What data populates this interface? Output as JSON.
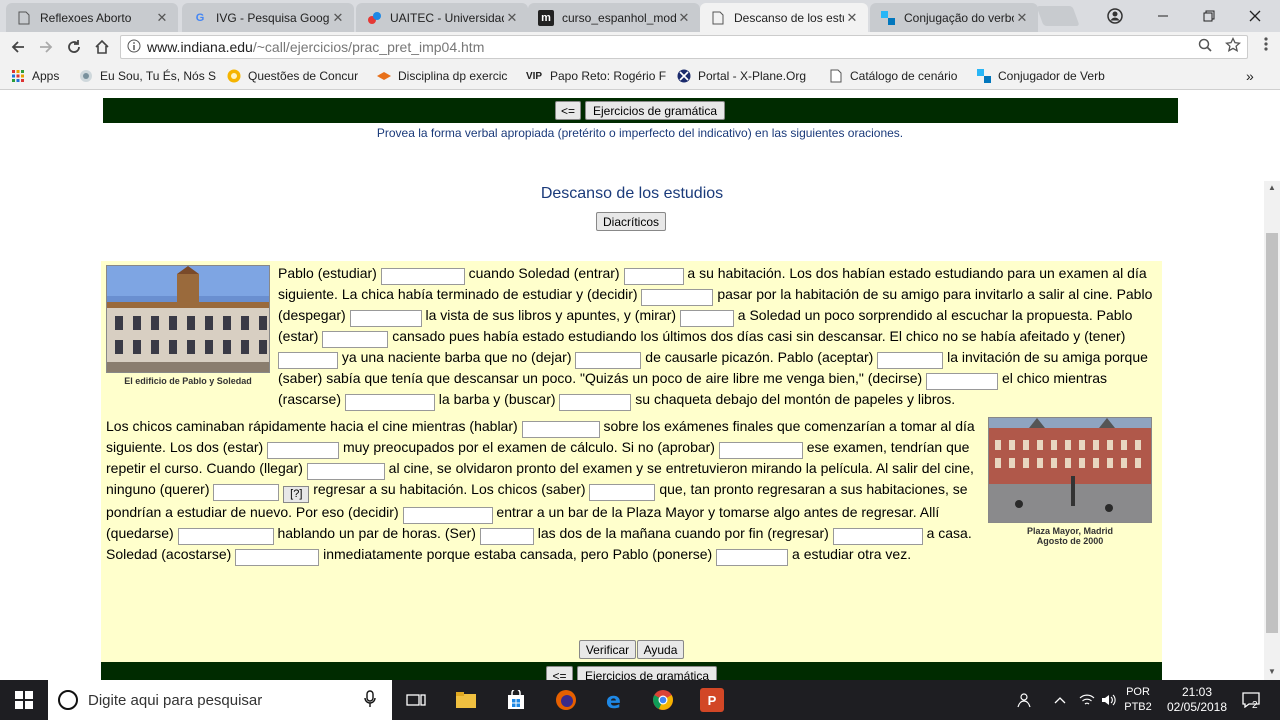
{
  "browser": {
    "tabs": [
      {
        "title": "Reflexoes Aborto",
        "icon": "document-icon",
        "active": false
      },
      {
        "title": "IVG - Pesquisa Google",
        "icon": "google-icon",
        "active": false
      },
      {
        "title": "UAITEC - Universidade",
        "icon": "uaitec-icon",
        "active": false
      },
      {
        "title": "curso_espanhol_mod",
        "icon": "moodle-icon",
        "active": false
      },
      {
        "title": "Descanso de los estu",
        "icon": "document-icon",
        "active": true
      },
      {
        "title": "Conjugação do verbo",
        "icon": "conjugacao-icon",
        "active": false
      }
    ],
    "close_glyph": "✕",
    "url_host": "www.indiana.edu",
    "url_path": "/~call/ejercicios/prac_pret_imp04.htm",
    "bookmarks": [
      {
        "label": "Apps",
        "icon": "apps-grid-icon"
      },
      {
        "label": "Eu Sou, Tu És, Nós S",
        "icon": "bookmark-site-icon"
      },
      {
        "label": "Questões de Concur",
        "icon": "questoes-icon"
      },
      {
        "label": "Disciplina dp exercic",
        "icon": "disciplina-icon"
      },
      {
        "label": "Papo Reto: Rogério F",
        "icon": "vip-icon"
      },
      {
        "label": "Portal - X-Plane.Org",
        "icon": "xplane-icon"
      },
      {
        "label": "Catálogo de cenário",
        "icon": "page-icon"
      },
      {
        "label": "Conjugador de Verb",
        "icon": "conjugador-icon"
      }
    ],
    "more_bookmarks": "»"
  },
  "page": {
    "top_nav": {
      "back_label": "<=",
      "grammar_label": "Ejercicios de gramática"
    },
    "instructions": "Provea la forma verbal apropiada (pretérito o imperfecto del indicativo) en las siguientes oraciones.",
    "title": "Descanso de los estudios",
    "diacritics_label": "Diacríticos",
    "photo1_caption": "El edificio de Pablo y Soledad",
    "photo2_caption_line1": "Plaza Mayor, Madrid",
    "photo2_caption_line2": "Agosto de 2000",
    "para1": [
      "Pablo (estudiar)",
      "cuando Soledad (entrar)",
      "a su habitación. Los dos habían estado estudiando para un examen al",
      "día siguiente. La chica había terminado de estudiar y (decidir)",
      "pasar por la habitación de su amigo para invitarlo a salir al cine.",
      "Pablo (despegar)",
      "la vista de sus libros y apuntes, y (mirar)",
      "a Soledad un poco sorprendido al escuchar la propuesta.",
      "Pablo (estar)",
      "cansado pues había estado estudiando los últimos dos días casi sin descansar. El chico no se había afeitado y",
      "(tener)",
      "ya una naciente barba que no (dejar)",
      "de causarle picazón. Pablo (aceptar)",
      "la invitación de su",
      "amiga porque (saber) sabía que tenía que descansar un poco. \"Quizás un poco de aire libre me venga bien,\" (decirse)",
      "el",
      "chico mientras (rascarse)",
      "la barba y (buscar)",
      "su chaqueta debajo del montón de papeles y libros."
    ],
    "para2": [
      "Los chicos caminaban rápidamente hacia el cine mientras (hablar)",
      "sobre los exámenes finales que comenzarían a tomar al",
      "día siguiente. Los dos (estar)",
      "muy preocupados por el examen de cálculo. Si no (aprobar)",
      "ese examen, tendrían",
      "que repetir el curso. Cuando (llegar)",
      "al cine, se olvidaron pronto del examen y se entretuvieron mirando la película. Al salir",
      "del cine, ninguno (querer)",
      "regresar a su habitación. Los chicos (saber)",
      "que, tan pronto regresaran a sus",
      "habitaciones, se pondrían a estudiar de nuevo. Por eso (decidir)",
      "entrar a un bar de la Plaza Mayor y tomarse algo antes de",
      "regresar. Allí (quedarse)",
      "hablando un par de horas. (Ser)",
      "las dos de la mañana cuando por fin (regresar)",
      "a casa. Soledad (acostarse)",
      "inmediatamente porque estaba cansada, pero Pablo (ponerse)",
      "a",
      "estudiar otra vez."
    ],
    "hint_label": "[?]",
    "verify_label": "Verificar",
    "help_label": "Ayuda",
    "bottom_nav": {
      "back_label": "<=",
      "grammar_label": "Ejercicios de gramática"
    }
  },
  "taskbar": {
    "search_placeholder": "Digite aqui para pesquisar",
    "lang_line1": "POR",
    "lang_line2": "PTB2",
    "time": "21:03",
    "date": "02/05/2018",
    "notification_count": "2"
  }
}
